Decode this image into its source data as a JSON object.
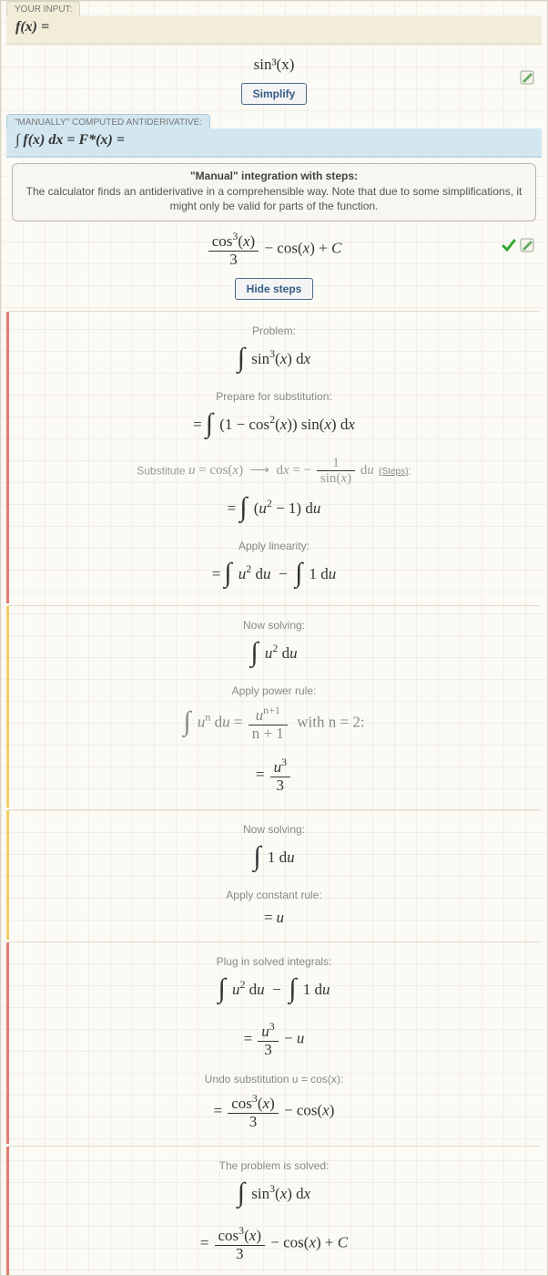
{
  "input_tab": "YOUR INPUT:",
  "input_formula": "f(x) =",
  "input_expression": "sin³(x)",
  "simplify_btn": "Simplify",
  "antideriv_tab": "\"MANUALLY\" COMPUTED ANTIDERIVATIVE:",
  "antideriv_formula": "∫ f(x) dx = F*(x) =",
  "info_title": "\"Manual\" integration with steps:",
  "info_text": "The calculator finds an antiderivative in a comprehensible way. Note that due to some simplifications, it might only be valid for parts of the function.",
  "result_html": "<span class='frac'><span class='num'>cos<sup>3</sup>(<i>x</i>)</span><span class='den'>3</span></span> − cos(<i>x</i>) + <i>C</i>",
  "hide_steps_btn": "Hide steps",
  "steps_link": "(Steps)",
  "labels": {
    "problem": "Problem:",
    "prepare": "Prepare for substitution:",
    "substitute_prefix": "Substitute ",
    "apply_linearity": "Apply linearity:",
    "now_solving": "Now solving:",
    "apply_power": "Apply power rule:",
    "apply_constant": "Apply constant rule:",
    "plug_in": "Plug in solved integrals:",
    "undo_sub": "Undo substitution u = cos(x):",
    "solved": "The problem is solved:"
  },
  "math": {
    "problem": "<span class='bigint'>∫</span> sin<sup>3</sup>(<i>x</i>) d<i>x</i>",
    "prepare": "<span class='bigint'>∫</span> (1 − cos<sup>2</sup>(<i>x</i>)) sin(<i>x</i>) d<i>x</i>",
    "substitute": "<i>u</i> = cos(<i>x</i>) &nbsp;⟶&nbsp; d<i>x</i> = − <span class='frac'><span class='num'>1</span><span class='den'>sin(<i>x</i>)</span></span> d<i>u</i>",
    "after_sub": "<span class='bigint'>∫</span> (<i>u</i><sup>2</sup> − 1) d<i>u</i>",
    "linearity": "<span class='bigint'>∫</span> <i>u</i><sup>2</sup> d<i>u</i> &nbsp;−&nbsp; <span class='bigint'>∫</span> 1 d<i>u</i>",
    "solve_u2": "<span class='bigint'>∫</span> <i>u</i><sup>2</sup> d<i>u</i>",
    "power_rule": "<span class='bigint'>∫</span> <i>u</i><sup>n</sup> d<i>u</i> = <span class='frac'><span class='num'><i>u</i><sup>n+1</sup></span><span class='den'>n + 1</span></span> &nbsp;with <span class='rm'>n</span> = 2:",
    "power_result": "<span class='frac'><span class='num'><i>u</i><sup>3</sup></span><span class='den'>3</span></span>",
    "solve_1": "<span class='bigint'>∫</span> 1 d<i>u</i>",
    "constant_result": "<i>u</i>",
    "plug_in": "<span class='bigint'>∫</span> <i>u</i><sup>2</sup> d<i>u</i> &nbsp;−&nbsp; <span class='bigint'>∫</span> 1 d<i>u</i>",
    "plug_result": "<span class='frac'><span class='num'><i>u</i><sup>3</sup></span><span class='den'>3</span></span> − <i>u</i>",
    "undo_result": "<span class='frac'><span class='num'>cos<sup>3</sup>(<i>x</i>)</span><span class='den'>3</span></span> − cos(<i>x</i>)",
    "final_a": "<span class='bigint'>∫</span> sin<sup>3</sup>(<i>x</i>) d<i>x</i>",
    "final_b": "<span class='frac'><span class='num'>cos<sup>3</sup>(<i>x</i>)</span><span class='den'>3</span></span> − cos(<i>x</i>) + <i>C</i>"
  }
}
